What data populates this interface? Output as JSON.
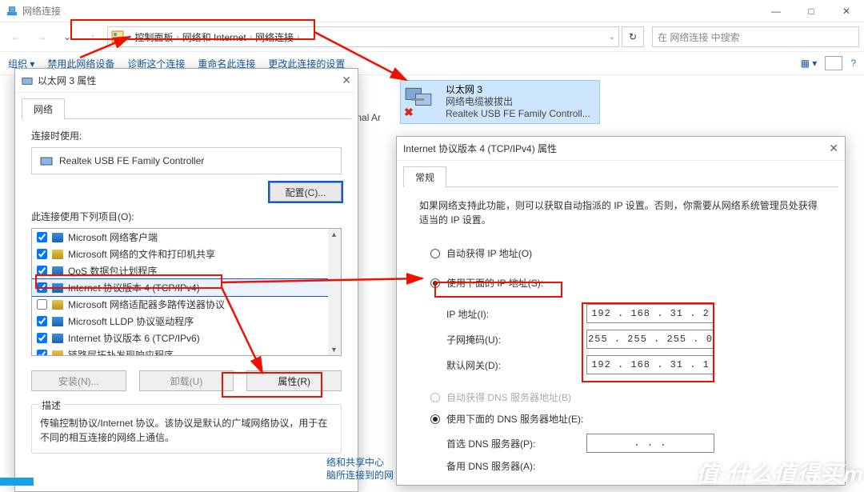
{
  "window": {
    "title": "网络连接",
    "minimize": "—",
    "maximize": "□",
    "close": "✕"
  },
  "nav": {
    "breadcrumb": [
      "控制面板",
      "网络和 Internet",
      "网络连接"
    ],
    "search_placeholder": "在 网络连接 中搜索"
  },
  "toolbar": {
    "organize": "组织 ▾",
    "items": [
      "禁用此网络设备",
      "诊断这个连接",
      "重命名此连接",
      "更改此连接的设置"
    ]
  },
  "adapter": {
    "name": "以太网 3",
    "status": "网络电缆被拔出",
    "device": "Realtek USB FE Family Controll..."
  },
  "partial_text": "ersonal Ar",
  "partial_footer_1": "络和共享中心",
  "partial_footer_2": "脑所连接到的网",
  "dlg1": {
    "title": "以太网 3 属性",
    "tab": "网络",
    "connect_using": "连接时使用:",
    "device": "Realtek USB FE Family Controller",
    "configure": "配置(C)...",
    "items_label": "此连接使用下列项目(O):",
    "list": [
      {
        "checked": true,
        "label": "Microsoft 网络客户端"
      },
      {
        "checked": true,
        "label": "Microsoft 网络的文件和打印机共享"
      },
      {
        "checked": true,
        "label": "QoS 数据包计划程序"
      },
      {
        "checked": true,
        "label": "Internet 协议版本 4 (TCP/IPv4)"
      },
      {
        "checked": false,
        "label": "Microsoft 网络适配器多路传送器协议"
      },
      {
        "checked": true,
        "label": "Microsoft LLDP 协议驱动程序"
      },
      {
        "checked": true,
        "label": "Internet 协议版本 6 (TCP/IPv6)"
      },
      {
        "checked": true,
        "label": "链路层拓扑发现响应程序"
      }
    ],
    "install": "安装(N)...",
    "uninstall": "卸载(U)",
    "properties": "属性(R)",
    "desc_label": "描述",
    "desc": "传输控制协议/Internet 协议。该协议是默认的广域网络协议，用于在不同的相互连接的网络上通信。"
  },
  "dlg2": {
    "title": "Internet 协议版本 4 (TCP/IPv4) 属性",
    "tab": "常规",
    "note": "如果网络支持此功能，则可以获取自动指派的 IP 设置。否则，你需要从网络系统管理员处获得适当的 IP 设置。",
    "auto_ip": "自动获得 IP 地址(O)",
    "manual_ip": "使用下面的 IP 地址(S):",
    "ip_label": "IP 地址(I):",
    "ip_value": "192 . 168 .  31  .   2",
    "mask_label": "子网掩码(U):",
    "mask_value": "255 . 255 . 255 .   0",
    "gw_label": "默认网关(D):",
    "gw_value": "192 . 168 .  31  .   1",
    "auto_dns": "自动获得 DNS 服务器地址(B)",
    "manual_dns": "使用下面的 DNS 服务器地址(E):",
    "dns1_label": "首选 DNS 服务器(P):",
    "dns1_value": " .       .       . ",
    "dns2_label": "备用 DNS 服务器(A):"
  },
  "watermark": "值·什么值得买m"
}
